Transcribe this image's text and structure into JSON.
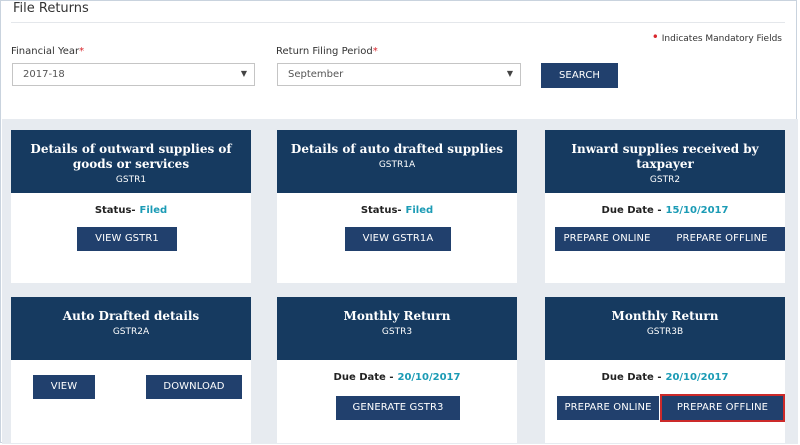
{
  "header": {
    "title": "File Returns",
    "mandatory_text": "Indicates Mandatory Fields",
    "mandatory_marker": "•"
  },
  "form": {
    "financial_year": {
      "label": "Financial Year",
      "required_marker": "*",
      "value": "2017-18"
    },
    "return_period": {
      "label": "Return Filing Period",
      "required_marker": "*",
      "value": "September"
    },
    "search_label": "SEARCH"
  },
  "cards": {
    "gstr1": {
      "title": "Details of outward supplies of goods or services",
      "code": "GSTR1",
      "status_label": "Status-",
      "status_value": "Filed",
      "button": "VIEW GSTR1"
    },
    "gstr1a": {
      "title": "Details of auto drafted supplies",
      "code": "GSTR1A",
      "status_label": "Status-",
      "status_value": "Filed",
      "button": "VIEW GSTR1A"
    },
    "gstr2": {
      "title": "Inward supplies received by taxpayer",
      "code": "GSTR2",
      "due_label": "Due Date -",
      "due_value": "15/10/2017",
      "button_online": "PREPARE ONLINE",
      "button_offline": "PREPARE OFFLINE"
    },
    "gstr2a": {
      "title": "Auto Drafted details",
      "code": "GSTR2A",
      "button_view": "VIEW",
      "button_download": "DOWNLOAD"
    },
    "gstr3": {
      "title": "Monthly Return",
      "code": "GSTR3",
      "due_label": "Due Date -",
      "due_value": "20/10/2017",
      "button": "GENERATE GSTR3"
    },
    "gstr3b": {
      "title": "Monthly Return",
      "code": "GSTR3B",
      "due_label": "Due Date -",
      "due_value": "20/10/2017",
      "button_online": "PREPARE ONLINE",
      "button_offline": "PREPARE OFFLINE"
    }
  },
  "colors": {
    "card_header": "#163a60",
    "button": "#21406d",
    "status_text": "#1b9bb5",
    "required": "#d9262c",
    "highlight": "#cc2a2a"
  }
}
